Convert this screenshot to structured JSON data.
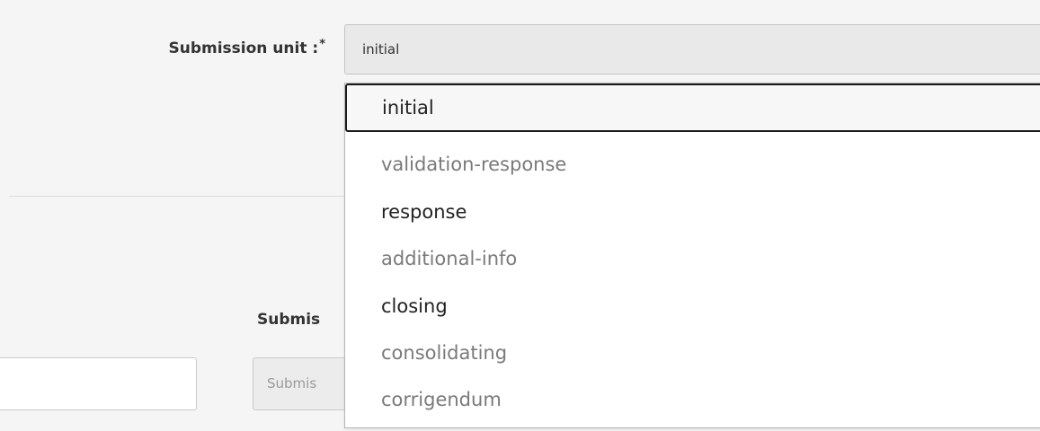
{
  "submission_unit": {
    "label": "Submission unit :",
    "required_marker": "*",
    "selected_value": "initial"
  },
  "dropdown": {
    "options": [
      {
        "label": "initial",
        "state": "selected"
      },
      {
        "label": "validation-response",
        "state": "disabled"
      },
      {
        "label": "response",
        "state": "enabled"
      },
      {
        "label": "additional-info",
        "state": "disabled"
      },
      {
        "label": "closing",
        "state": "enabled"
      },
      {
        "label": "consolidating",
        "state": "disabled"
      },
      {
        "label": "corrigendum",
        "state": "disabled"
      }
    ]
  },
  "second_field": {
    "label": "Submis",
    "placeholder": "Submis"
  }
}
